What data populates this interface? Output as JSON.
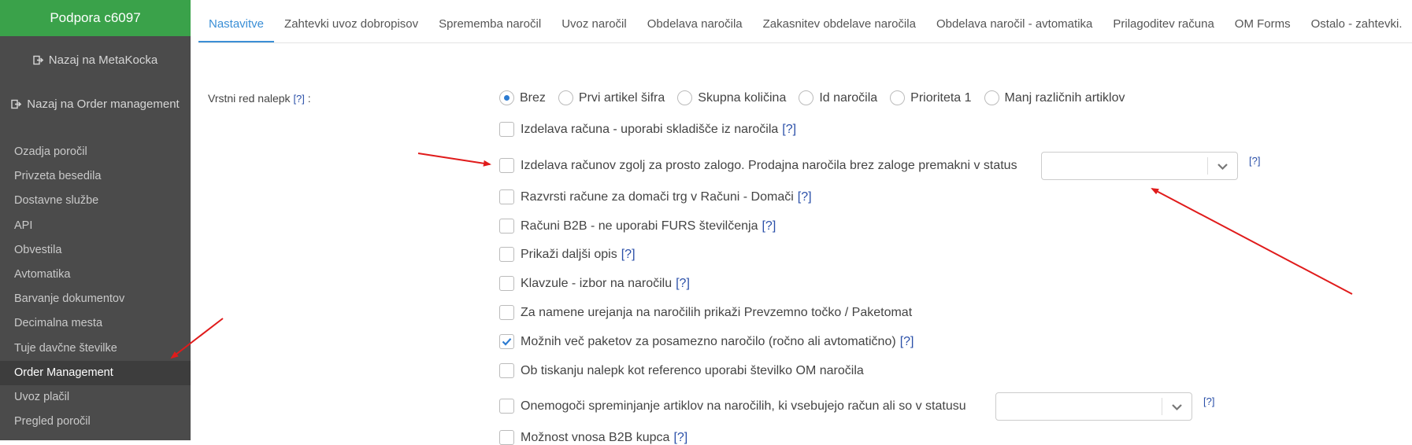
{
  "sidebar": {
    "title": "Podpora c6097",
    "back_links": [
      {
        "label": "Nazaj na MetaKocka",
        "icon": "sign-out-icon"
      },
      {
        "label": "Nazaj na Order management",
        "icon": "sign-out-icon"
      }
    ],
    "items": [
      {
        "label": "Ozadja poročil"
      },
      {
        "label": "Privzeta besedila"
      },
      {
        "label": "Dostavne službe"
      },
      {
        "label": "API"
      },
      {
        "label": "Obvestila"
      },
      {
        "label": "Avtomatika"
      },
      {
        "label": "Barvanje dokumentov"
      },
      {
        "label": "Decimalna mesta"
      },
      {
        "label": "Tuje davčne številke"
      },
      {
        "label": "Order Management",
        "active": true
      },
      {
        "label": "Uvoz plačil"
      },
      {
        "label": "Pregled poročil"
      }
    ]
  },
  "tabs": [
    {
      "label": "Nastavitve",
      "active": true
    },
    {
      "label": "Zahtevki uvoz dobropisov"
    },
    {
      "label": "Sprememba naročil"
    },
    {
      "label": "Uvoz naročil"
    },
    {
      "label": "Obdelava naročila"
    },
    {
      "label": "Zakasnitev obdelave naročila"
    },
    {
      "label": "Obdelava naročil - avtomatika"
    },
    {
      "label": "Prilagoditev računa"
    },
    {
      "label": "OM Forms"
    },
    {
      "label": "Ostalo - zahtevki."
    }
  ],
  "form": {
    "label_order": "Vrstni red nalepk",
    "help": "[?]",
    "label_colon": ":",
    "radio_options": [
      {
        "label": "Brez",
        "checked": true
      },
      {
        "label": "Prvi artikel šifra",
        "checked": false
      },
      {
        "label": "Skupna količina",
        "checked": false
      },
      {
        "label": "Id naročila",
        "checked": false
      },
      {
        "label": "Prioriteta 1",
        "checked": false
      },
      {
        "label": "Manj različnih artiklov",
        "checked": false
      }
    ],
    "checkboxes": [
      {
        "label": "Izdelava računa - uporabi skladišče iz naročila",
        "checked": false,
        "help": "[?]"
      },
      {
        "label": "Izdelava računov zgolj za prosto zalogo. Prodajna naročila brez zaloge premakni v status",
        "checked": false,
        "select_value": "",
        "side_help": "[?]"
      },
      {
        "label": "Razvrsti račune za domači trg v Računi - Domači",
        "checked": false,
        "help": "[?]"
      },
      {
        "label": "Računi B2B - ne uporabi FURS številčenja",
        "checked": false,
        "help": "[?]"
      },
      {
        "label": "Prikaži daljši opis",
        "checked": false,
        "help": "[?]"
      },
      {
        "label": "Klavzule - izbor na naročilu",
        "checked": false,
        "help": "[?]"
      },
      {
        "label": "Za namene urejanja na naročilih prikaži Prevzemno točko / Paketomat",
        "checked": false
      },
      {
        "label": "Možnih več paketov za posamezno naročilo (ročno ali avtomatično)",
        "checked": true,
        "help": "[?]"
      },
      {
        "label": "Ob tiskanju nalepk kot referenco uporabi številko OM naročila",
        "checked": false
      },
      {
        "label": "Onemogoči spreminjanje artiklov na naročilih, ki vsebujejo račun ali so v statusu",
        "checked": false,
        "select_value": "",
        "side_help": "[?]"
      },
      {
        "label": "Možnost vnosa B2B kupca",
        "checked": false,
        "help": "[?]"
      }
    ]
  },
  "colors": {
    "sidebar_bg": "#4b4b4b",
    "sidebar_header": "#3aa24a",
    "tab_active": "#3b8fd6",
    "checkbox_check": "#2c7bd1",
    "annotation_arrow": "#e01b1b"
  }
}
